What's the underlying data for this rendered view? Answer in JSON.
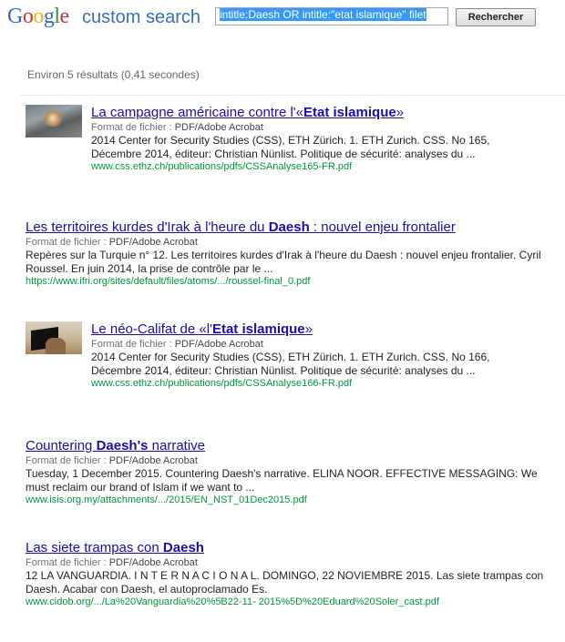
{
  "header": {
    "logo_text": "Google",
    "logo_sub": "custom search",
    "search_value": "intitle:Daesh OR intitle:\"etat islamique\" filet",
    "search_button": "Rechercher"
  },
  "stats": "Environ 5 résultats (0,41 secondes)",
  "results": [
    {
      "title_pre": "La campagne américaine contre l'«",
      "title_bold": "Etat islamique",
      "title_post": "»",
      "meta_label": "Format de fichier :",
      "meta_value": "PDF/Adobe Acrobat",
      "snippet": "2014 Center for Security Studies (CSS), ETH Zürich. 1. ETH Zurich. CSS. No 165, Décembre 2014, éditeur: Christian Nünlist. Politique de sécurité: analyses du ...",
      "url": "www.css.ethz.ch/publications/pdfs/CSSAnalyse165-FR.pdf"
    },
    {
      "title_pre": "Les territoires kurdes d'Irak à l'heure du ",
      "title_bold": "Daesh",
      "title_post": " : nouvel enjeu frontalier",
      "meta_label": "Format de fichier :",
      "meta_value": "PDF/Adobe Acrobat",
      "snippet": "Repères sur la Turquie n° 12. Les territoires kurdes d'Irak à l'heure du Daesh : nouvel enjeu frontalier. Cyril Roussel. En juin 2014, la prise de contrôle par le ...",
      "url": "https://www.ifri.org/sites/default/files/atoms/.../roussel-final_0.pdf"
    },
    {
      "title_pre": "Le néo-Califat de «l'",
      "title_bold": "Etat islamique",
      "title_post": "»",
      "meta_label": "Format de fichier :",
      "meta_value": "PDF/Adobe Acrobat",
      "snippet": "2014 Center for Security Studies (CSS), ETH Zürich. 1. ETH Zurich. CSS. No 166, Décembre 2014, éditeur: Christian Nünlist. Politique de sécurité: analyses du ...",
      "url": "www.css.ethz.ch/publications/pdfs/CSSAnalyse166-FR.pdf"
    },
    {
      "title_pre": "Countering ",
      "title_bold": "Daesh's",
      "title_post": " narrative",
      "meta_label": "Format de fichier :",
      "meta_value": "PDF/Adobe Acrobat",
      "snippet": "Tuesday, 1 December 2015. Countering Daesh's narrative. ELINA NOOR. EFFECTIVE MESSAGING: We must reclaim our brand of Islam if we want to ...",
      "url": "www.isis.org.my/attachments/.../2015/EN_NST_01Dec2015.pdf"
    },
    {
      "title_pre": "Las siete trampas con ",
      "title_bold": "Daesh",
      "title_post": "",
      "meta_label": "Format de fichier :",
      "meta_value": "PDF/Adobe Acrobat",
      "snippet": "12 LA VANGUARDIA. I N T E R N A C I O N A L. DOMINGO, 22 NOVIEMBRE 2015. Las siete trampas con Daesh. Acabar con Daesh, el autoproclamado Es.",
      "url": "www.cidob.org/.../La%20Vanguardia%20%5B22-11- 2015%5D%20Eduard%20Soler_cast.pdf"
    }
  ]
}
